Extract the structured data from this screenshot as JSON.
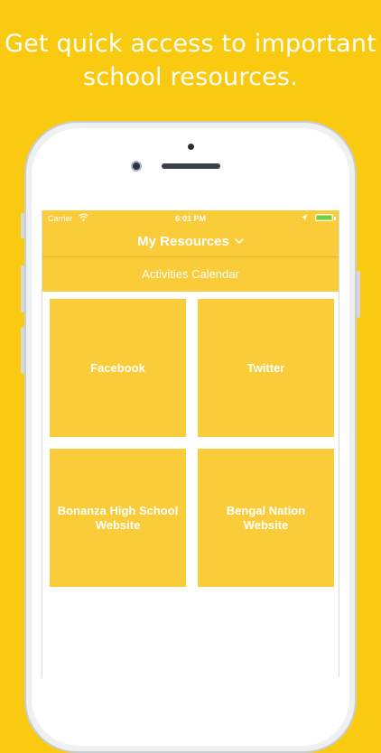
{
  "promo": {
    "line1": "Get quick access to important",
    "line2": "school resources."
  },
  "status_bar": {
    "carrier": "Carrier",
    "time": "6:01 PM",
    "wifi_icon": "wifi-icon",
    "location_icon": "location-arrow-icon",
    "battery_icon": "battery-icon"
  },
  "nav": {
    "title": "My Resources",
    "dropdown_icon": "chevron-down-icon"
  },
  "section": {
    "label": "Activities Calendar"
  },
  "tiles": [
    {
      "label": "Facebook"
    },
    {
      "label": "Twitter"
    },
    {
      "label": "Bonanza High School Website"
    },
    {
      "label": "Bengal Nation Website"
    }
  ],
  "colors": {
    "background": "#F9CA0F",
    "accent": "#FACC3A",
    "text": "#FFFFFF",
    "battery": "#4CD964"
  }
}
